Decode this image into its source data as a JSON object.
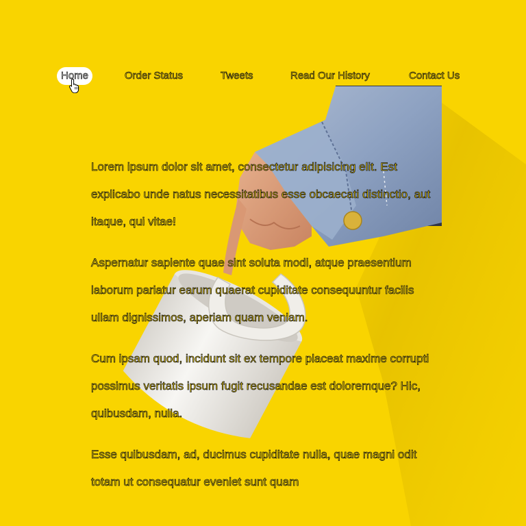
{
  "nav": {
    "items": [
      {
        "label": "Home",
        "active": true
      },
      {
        "label": "Order Status"
      },
      {
        "label": "Tweets"
      },
      {
        "label": "Read Our History"
      },
      {
        "label": "Contact Us"
      }
    ]
  },
  "content": {
    "paragraphs": [
      "Lorem ipsum dolor sit amet, consectetur adipisicing elit. Est explicabo unde natus necessitatibus esse obcaecati distinctio, aut itaque, qui vitae!",
      "Aspernatur sapiente quae sint soluta modi, atque praesentium laborum pariatur earum quaerat cupiditate consequuntur facilis ullam dignissimos, aperiam quam veniam.",
      "Cum ipsam quod, incidunt sit ex tempore placeat maxime corrupti possimus veritatis ipsum fugit recusandae est doloremque? Hic, quibusdam, nulla.",
      "Esse quibusdam, ad, ducimus cupiditate nulla, quae magni odit totam ut consequatur eveniet sunt quam"
    ]
  },
  "colors": {
    "background": "#f9d400",
    "text_outline": "#141414",
    "denim": "#8ea2c2",
    "mug": "#f2f0ec"
  },
  "icons": {
    "cursor": "hand-pointer-icon"
  }
}
